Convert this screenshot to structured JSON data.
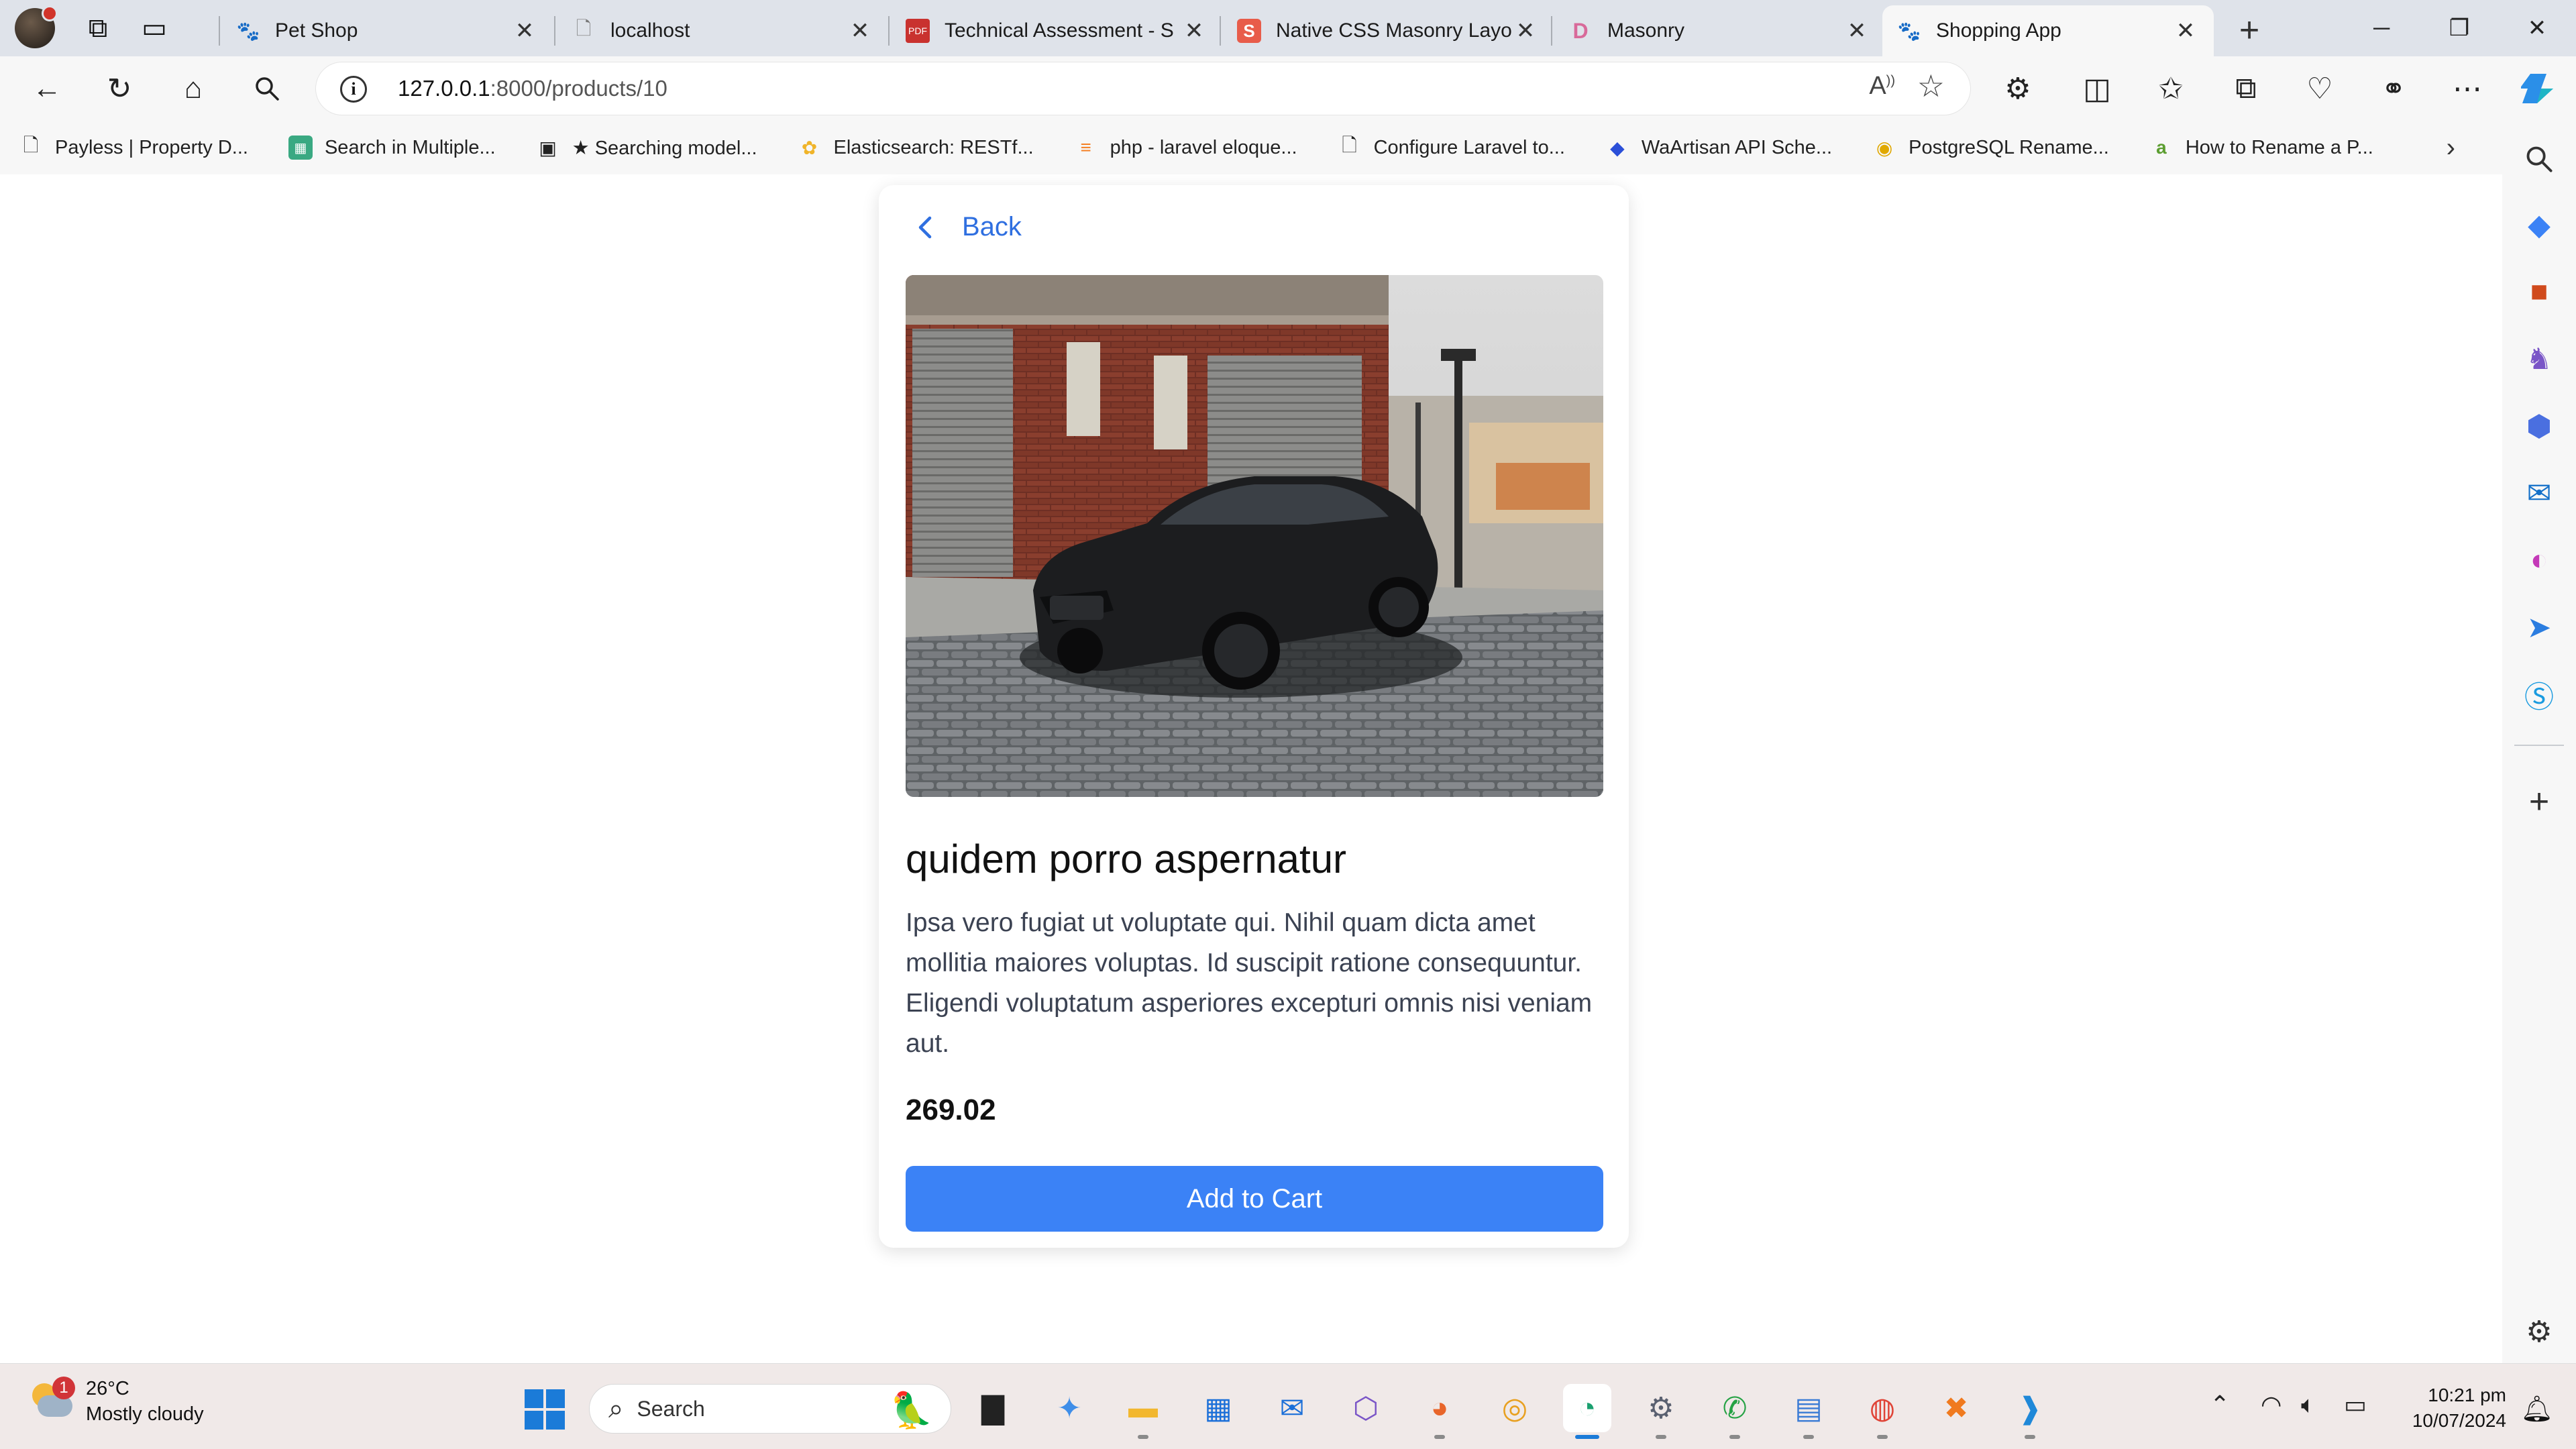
{
  "tabs": [
    {
      "title": "Pet Shop",
      "favicon": "paw-icon"
    },
    {
      "title": "localhost",
      "favicon": "page-icon"
    },
    {
      "title": "Technical Assessment - S",
      "favicon": "pdf-icon"
    },
    {
      "title": "Native CSS Masonry Layo",
      "favicon": "smashing-icon"
    },
    {
      "title": "Masonry",
      "favicon": "d-logo-icon"
    },
    {
      "title": "Shopping App",
      "favicon": "paw-icon",
      "active": true
    }
  ],
  "address_bar": {
    "url_host": "127.0.0.1",
    "url_path": ":8000/products/10"
  },
  "bookmarks": [
    {
      "label": "Payless | Property D...",
      "icon": "page-icon"
    },
    {
      "label": "Search in Multiple...",
      "icon": "green-grid-icon"
    },
    {
      "label": "★ Searching model...",
      "icon": "film-icon"
    },
    {
      "label": "Elasticsearch: RESTf...",
      "icon": "elastic-icon"
    },
    {
      "label": "php - laravel eloque...",
      "icon": "stackoverflow-icon"
    },
    {
      "label": "Configure Laravel to...",
      "icon": "page-icon"
    },
    {
      "label": "WaArtisan API Sche...",
      "icon": "blue-diamond-icon"
    },
    {
      "label": "PostgreSQL Rename...",
      "icon": "chrome-style-icon"
    },
    {
      "label": "How to Rename a P...",
      "icon": "green-a-icon"
    }
  ],
  "product": {
    "back_label": "Back",
    "title": "quidem porro aspernatur",
    "description": "Ipsa vero fugiat ut voluptate qui. Nihil quam dicta amet mollitia maiores voluptas. Id suscipit ratione consequuntur. Eligendi voluptatum asperiores excepturi omnis nisi veniam aut.",
    "price": "269.02",
    "add_to_cart_label": "Add to Cart"
  },
  "weather": {
    "temp": "26°C",
    "condition": "Mostly cloudy",
    "badge": "1"
  },
  "taskbar": {
    "search_placeholder": "Search"
  },
  "clock": {
    "time": "10:21 pm",
    "date": "10/07/2024"
  },
  "colors": {
    "accent": "#3b82f6",
    "link": "#2f6fe0",
    "tabstrip": "#dfe3ea",
    "taskbar": "#f0e9e8"
  }
}
